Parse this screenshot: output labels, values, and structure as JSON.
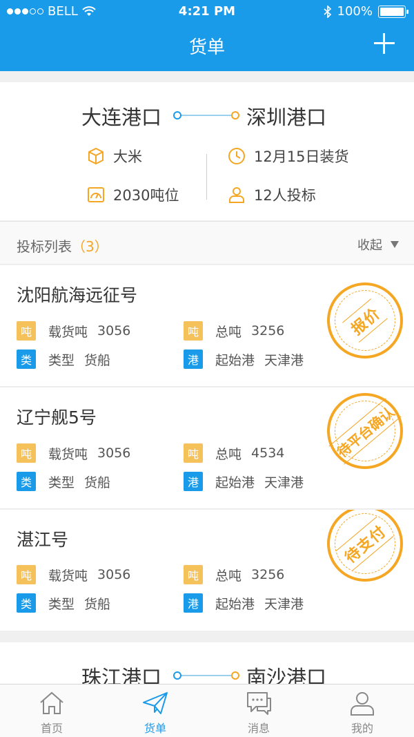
{
  "status_bar": {
    "carrier": "BELL",
    "time": "4:21 PM",
    "battery": "100%"
  },
  "nav": {
    "title": "货单",
    "add_icon": "plus-icon"
  },
  "order": {
    "from_port": "大连港口",
    "to_port": "深圳港口",
    "cargo": "大米",
    "load_date": "12月15日装货",
    "tonnage": "2030吨位",
    "bidders": "12人投标"
  },
  "bid_list": {
    "title": "投标列表",
    "count": "（3）",
    "collapse_label": "收起"
  },
  "bids": [
    {
      "vessel": "沈阳航海远征号",
      "load_badge": "吨",
      "load_label": "载货吨",
      "load_value": "3056",
      "total_badge": "吨",
      "total_label": "总吨",
      "total_value": "3256",
      "type_badge": "类",
      "type_label": "类型",
      "type_value": "货船",
      "port_badge": "港",
      "port_label": "起始港",
      "port_value": "天津港",
      "status": "报价"
    },
    {
      "vessel": "辽宁舰5号",
      "load_badge": "吨",
      "load_label": "载货吨",
      "load_value": "3056",
      "total_badge": "吨",
      "total_label": "总吨",
      "total_value": "4534",
      "type_badge": "类",
      "type_label": "类型",
      "type_value": "货船",
      "port_badge": "港",
      "port_label": "起始港",
      "port_value": "天津港",
      "status": "待平台确认"
    },
    {
      "vessel": "湛江号",
      "load_badge": "吨",
      "load_label": "载货吨",
      "load_value": "3056",
      "total_badge": "吨",
      "total_label": "总吨",
      "total_value": "3256",
      "type_badge": "类",
      "type_label": "类型",
      "type_value": "货船",
      "port_badge": "港",
      "port_label": "起始港",
      "port_value": "天津港",
      "status": "待支付"
    }
  ],
  "order2": {
    "from_port": "珠江港口",
    "to_port": "南沙港口"
  },
  "tabs": [
    {
      "label": "首页",
      "icon": "home-icon"
    },
    {
      "label": "货单",
      "icon": "paper-plane-icon"
    },
    {
      "label": "消息",
      "icon": "chat-icon"
    },
    {
      "label": "我的",
      "icon": "user-icon"
    }
  ],
  "colors": {
    "primary": "#1a9bea",
    "accent": "#f5a623"
  }
}
